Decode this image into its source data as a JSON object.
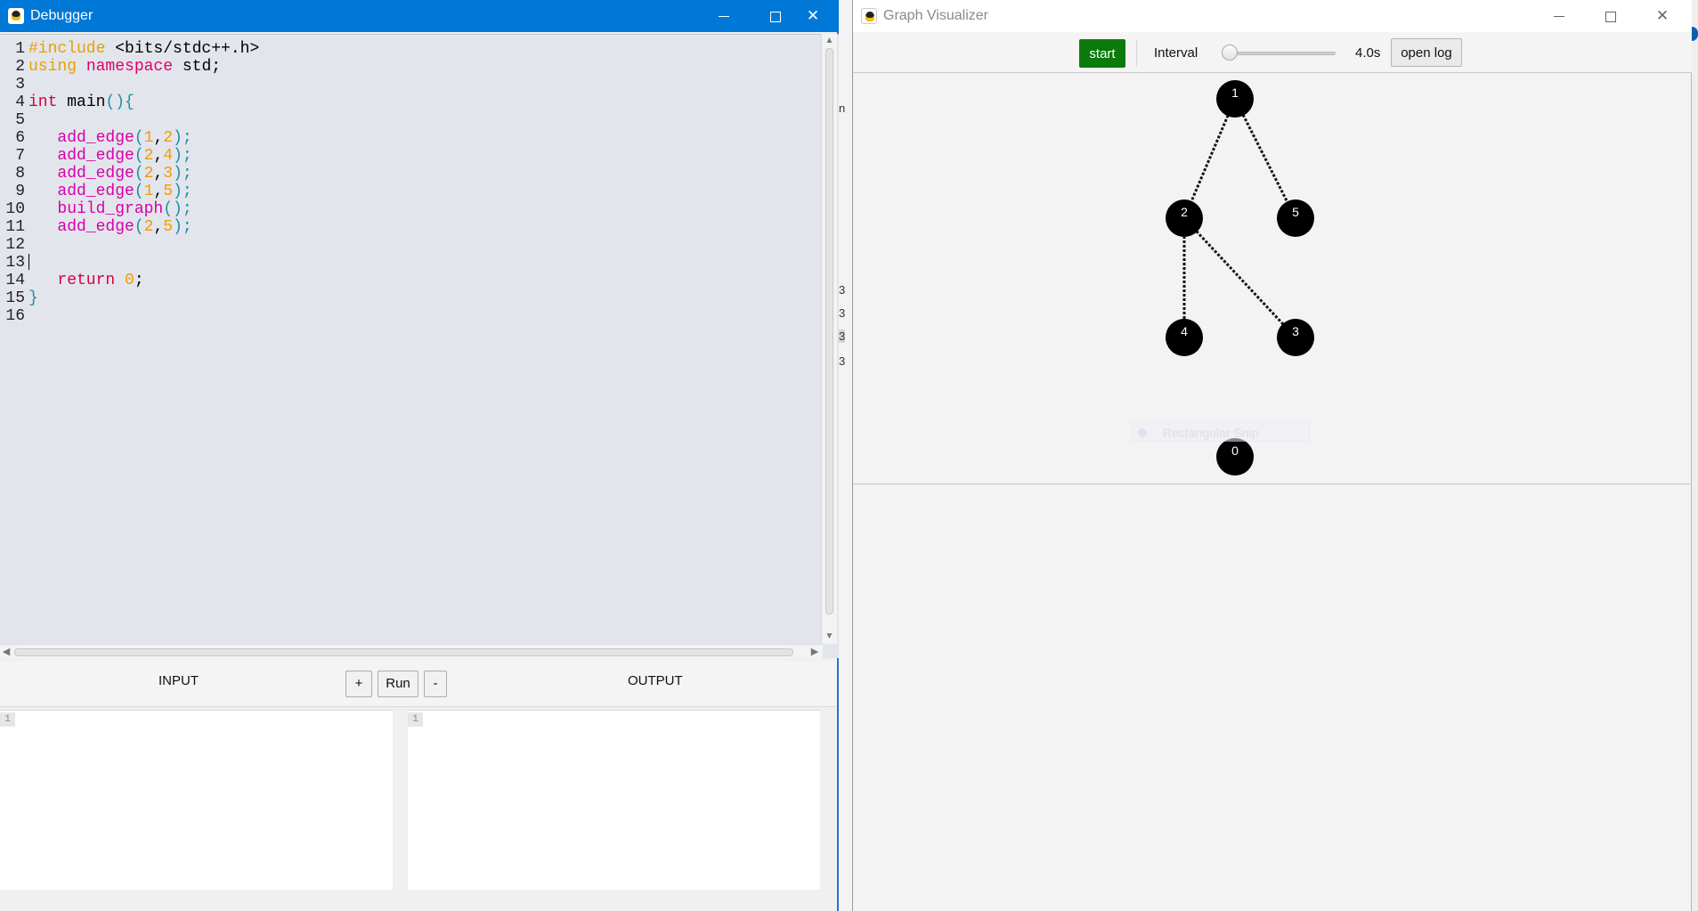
{
  "debugger": {
    "title": "Debugger",
    "gutter": [
      "1",
      "2",
      "3",
      "4",
      "5",
      "6",
      "7",
      "8",
      "9",
      "10",
      "11",
      "12",
      "13",
      "14",
      "15",
      "16"
    ],
    "code_lines": [
      [
        {
          "t": "#include ",
          "c": "pp"
        },
        {
          "t": "<bits/stdc++.h>",
          "c": "pl"
        }
      ],
      [
        {
          "t": "using ",
          "c": "pp"
        },
        {
          "t": "namespace ",
          "c": "kw"
        },
        {
          "t": "std;",
          "c": "pl"
        }
      ],
      [],
      [
        {
          "t": "int ",
          "c": "type"
        },
        {
          "t": "main",
          "c": "pl"
        },
        {
          "t": "(){",
          "c": "br"
        }
      ],
      [],
      [
        {
          "t": "   ",
          "c": "pl"
        },
        {
          "t": "add_edge",
          "c": "fn"
        },
        {
          "t": "(",
          "c": "br"
        },
        {
          "t": "1",
          "c": "num"
        },
        {
          "t": ",",
          "c": "pl"
        },
        {
          "t": "2",
          "c": "num"
        },
        {
          "t": ");",
          "c": "br"
        }
      ],
      [
        {
          "t": "   ",
          "c": "pl"
        },
        {
          "t": "add_edge",
          "c": "fn"
        },
        {
          "t": "(",
          "c": "br"
        },
        {
          "t": "2",
          "c": "num"
        },
        {
          "t": ",",
          "c": "pl"
        },
        {
          "t": "4",
          "c": "num"
        },
        {
          "t": ");",
          "c": "br"
        }
      ],
      [
        {
          "t": "   ",
          "c": "pl"
        },
        {
          "t": "add_edge",
          "c": "fn"
        },
        {
          "t": "(",
          "c": "br"
        },
        {
          "t": "2",
          "c": "num"
        },
        {
          "t": ",",
          "c": "pl"
        },
        {
          "t": "3",
          "c": "num"
        },
        {
          "t": ");",
          "c": "br"
        }
      ],
      [
        {
          "t": "   ",
          "c": "pl"
        },
        {
          "t": "add_edge",
          "c": "fn"
        },
        {
          "t": "(",
          "c": "br"
        },
        {
          "t": "1",
          "c": "num"
        },
        {
          "t": ",",
          "c": "pl"
        },
        {
          "t": "5",
          "c": "num"
        },
        {
          "t": ");",
          "c": "br"
        }
      ],
      [
        {
          "t": "   ",
          "c": "pl"
        },
        {
          "t": "build_graph",
          "c": "fn"
        },
        {
          "t": "();",
          "c": "br"
        }
      ],
      [
        {
          "t": "   ",
          "c": "pl"
        },
        {
          "t": "add_edge",
          "c": "fn"
        },
        {
          "t": "(",
          "c": "br"
        },
        {
          "t": "2",
          "c": "num"
        },
        {
          "t": ",",
          "c": "pl"
        },
        {
          "t": "5",
          "c": "num"
        },
        {
          "t": ");",
          "c": "br"
        }
      ],
      [],
      [
        {
          "t": "",
          "c": "caret"
        }
      ],
      [
        {
          "t": "   ",
          "c": "pl"
        },
        {
          "t": "return ",
          "c": "type"
        },
        {
          "t": "0",
          "c": "num"
        },
        {
          "t": ";",
          "c": "pl"
        }
      ],
      [
        {
          "t": "}",
          "c": "br"
        }
      ],
      []
    ],
    "io": {
      "input_label": "INPUT",
      "output_label": "OUTPUT",
      "plus_label": "+",
      "run_label": "Run",
      "minus_label": "-",
      "input_line": "1",
      "output_line": "1"
    }
  },
  "background_sliver": [
    "n",
    "3",
    "3",
    "3",
    "3"
  ],
  "visualizer": {
    "title": "Graph Visualizer",
    "start_label": "start",
    "interval_label": "Interval",
    "interval_value": "4.0s",
    "interval_fraction": 0.0,
    "open_log_label": "open log",
    "ghost_text": "Rectangular Snip",
    "nodes": [
      "1",
      "2",
      "5",
      "4",
      "3",
      "0"
    ],
    "edges": [
      [
        "1",
        "2"
      ],
      [
        "1",
        "5"
      ],
      [
        "2",
        "4"
      ],
      [
        "2",
        "3"
      ]
    ]
  },
  "colors": {
    "titlebar_active": "#0078d7",
    "start_button": "#0a7a0a",
    "node_fill": "#000000",
    "editor_bg": "#e3e5ec"
  }
}
